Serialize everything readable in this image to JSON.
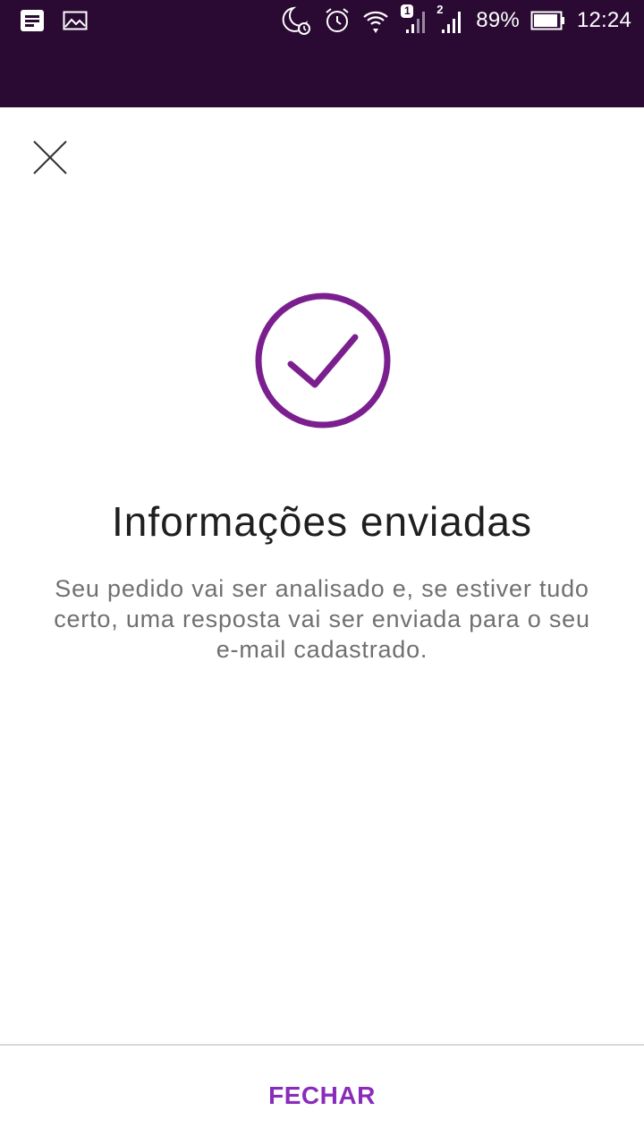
{
  "status_bar": {
    "battery": "89%",
    "time": "12:24",
    "sim1_badge": "1",
    "sim2_badge": "2",
    "icons": [
      "notes-icon",
      "image-icon",
      "night-alarm-icon",
      "alarm-clock-icon",
      "wifi-icon",
      "signal-sim1-icon",
      "signal-sim2-icon",
      "battery-icon"
    ]
  },
  "header": {
    "close_icon": "close-icon"
  },
  "content": {
    "icon": "check-circle-icon",
    "title": "Informações enviadas",
    "message": "Seu pedido vai ser analisado e, se estiver tudo certo, uma resposta vai ser enviada para o seu e-mail cadastrado."
  },
  "footer": {
    "close_label": "FECHAR"
  },
  "colors": {
    "status_bar_bg": "#2a0a33",
    "accent": "#8a2cbb",
    "check_circle": "#7b1f8f"
  }
}
